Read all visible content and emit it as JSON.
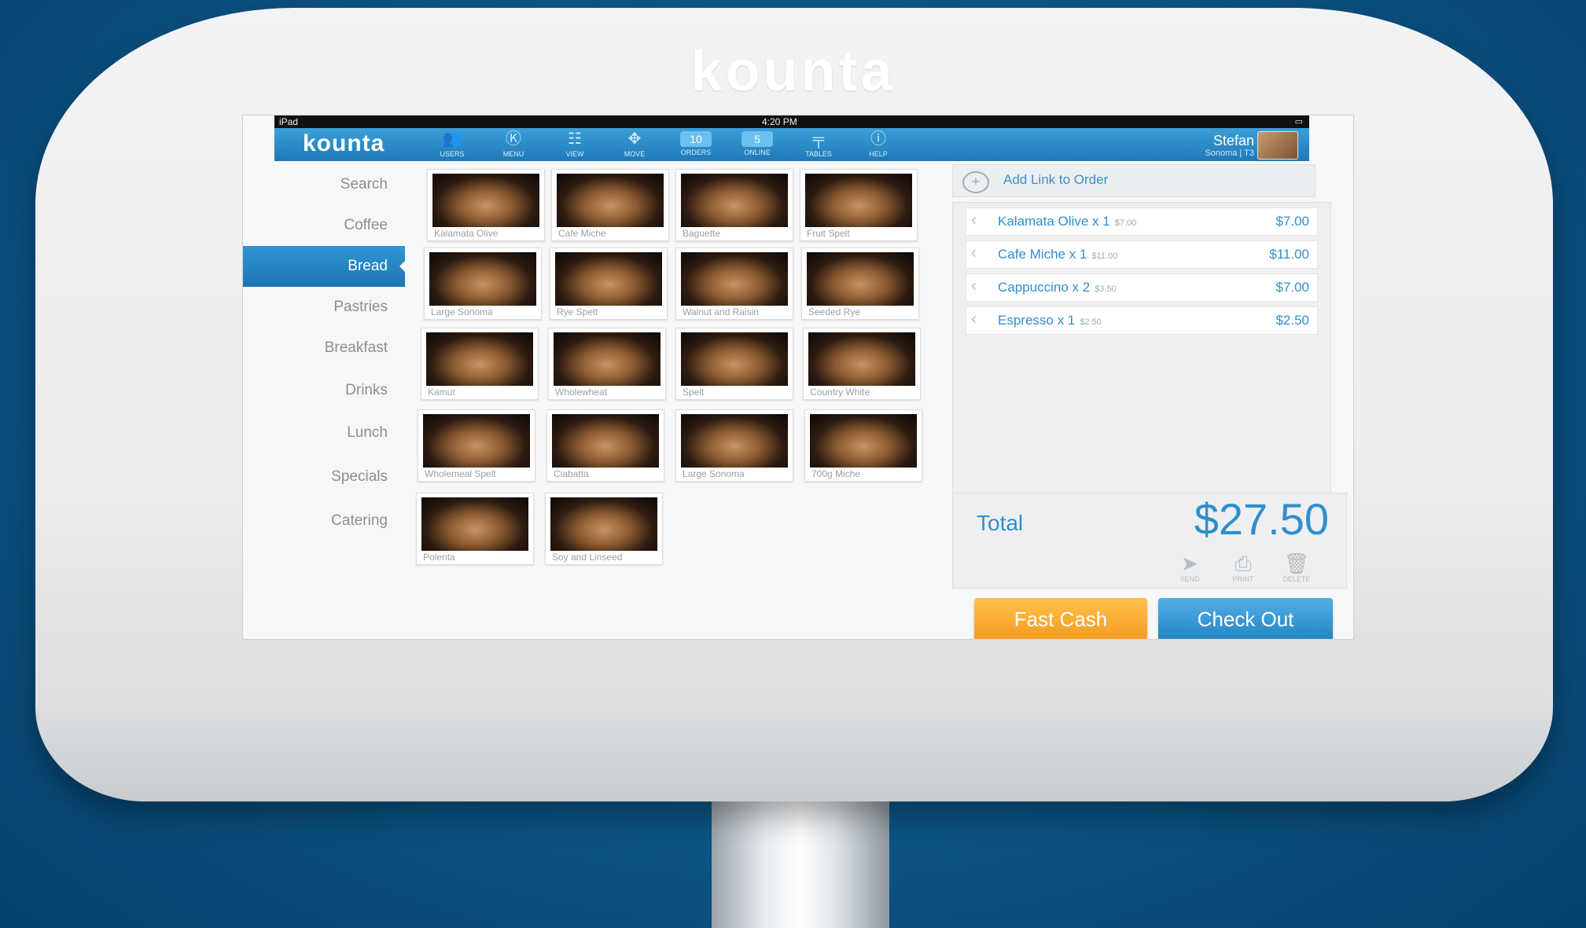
{
  "device_brand": "kounta",
  "status_bar": {
    "device": "iPad",
    "time": "4:20 PM"
  },
  "header": {
    "logo": "kounta",
    "nav": [
      {
        "label": "USERS",
        "icon": "users-icon",
        "badge": ""
      },
      {
        "label": "MENU",
        "icon": "menu-icon",
        "badge": ""
      },
      {
        "label": "VIEW",
        "icon": "view-icon",
        "badge": ""
      },
      {
        "label": "MOVE",
        "icon": "move-icon",
        "badge": ""
      },
      {
        "label": "ORDERS",
        "icon": "orders-icon",
        "badge": "10"
      },
      {
        "label": "ONLINE",
        "icon": "online-icon",
        "badge": "5"
      },
      {
        "label": "TABLES",
        "icon": "tables-icon",
        "badge": ""
      },
      {
        "label": "HELP",
        "icon": "help-icon",
        "badge": ""
      }
    ],
    "user_name": "Stefan",
    "user_location": "Sonoma | T3"
  },
  "categories": [
    "Search",
    "Coffee",
    "Bread",
    "Pastries",
    "Breakfast",
    "Drinks",
    "Lunch",
    "Specials",
    "Catering"
  ],
  "active_category": "Bread",
  "products": [
    "Kalamata Olive",
    "Cafe Miche",
    "Baguette",
    "Fruit Spelt",
    "Large Sonoma",
    "Rye Spelt",
    "Walnut and Raisin",
    "Seeded Rye",
    "Kamut",
    "Wholewheat",
    "Spelt",
    "Country White",
    "Wholemeal Spelt",
    "Ciabatta",
    "Large Sonoma",
    "700g Miche",
    "Polenta",
    "Soy and Linseed"
  ],
  "order": {
    "add_link_label": "Add Link to Order",
    "lines": [
      {
        "item": "Kalamata Olive x 1",
        "unit": "$7.00",
        "price": "$7.00"
      },
      {
        "item": "Cafe Miche x 1",
        "unit": "$11.00",
        "price": "$11.00"
      },
      {
        "item": "Cappuccino x 2",
        "unit": "$3.50",
        "price": "$7.00"
      },
      {
        "item": "Espresso x 1",
        "unit": "$2.50",
        "price": "$2.50"
      }
    ],
    "total_label": "Total",
    "total_amount": "$27.50",
    "actions": [
      "SEND",
      "PRINT",
      "DELETE"
    ]
  },
  "buttons": {
    "fast_cash": "Fast Cash",
    "check_out": "Check Out"
  },
  "colors": {
    "accent_blue": "#2285c4",
    "fast_cash_orange": "#f59a1f",
    "header_blue": "#1f79b7"
  }
}
